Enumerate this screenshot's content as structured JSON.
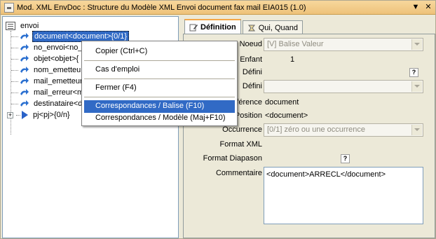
{
  "window": {
    "title": "Mod. XML EnvDoc : Structure du Modèle XML Envoi document fax mail EIA015 (1.0)",
    "controls": [
      "▼",
      "✕"
    ]
  },
  "tree": {
    "root": {
      "label": "envoi",
      "icon": "xml-doc-icon"
    },
    "items": [
      {
        "label": "document<document>{0/1}",
        "icon": "element-arrow-icon",
        "selected": true
      },
      {
        "label": "no_envoi<no_",
        "icon": "element-arrow-icon"
      },
      {
        "label": "objet<objet>{",
        "icon": "element-arrow-icon"
      },
      {
        "label": "nom_emetteur<",
        "icon": "element-arrow-icon"
      },
      {
        "label": "mail_emetteur<",
        "icon": "element-arrow-icon"
      },
      {
        "label": "mail_erreur<ma",
        "icon": "element-arrow-icon"
      },
      {
        "label": "destinataire<d",
        "icon": "element-arrow-icon"
      },
      {
        "label": "pj<pj>{0/n}",
        "icon": "play-icon",
        "expander": "+"
      }
    ]
  },
  "tabs": [
    {
      "label": "Définition",
      "active": true,
      "icon": "pencil-icon"
    },
    {
      "label": "Qui, Quand",
      "active": false,
      "icon": "clock-icon"
    }
  ],
  "form": {
    "type_noeud": {
      "label": "Type Noeud",
      "value": "[V] Balise Valeur"
    },
    "nb_enfant": {
      "label": "Nb Enfant",
      "value": "1"
    },
    "defini1": {
      "label": "Défini"
    },
    "defini2": {
      "label": "Défini"
    },
    "reference": {
      "label": "Référence",
      "value": "document"
    },
    "balise": {
      "label": "Balise/Position",
      "value": "<document>"
    },
    "occurrence": {
      "label": "Occurrence",
      "value": "[0/1] zéro ou une occurrence"
    },
    "format_xml": {
      "label": "Format XML"
    },
    "format_diapason": {
      "label": "Format Diapason"
    },
    "commentaire": {
      "label": "Commentaire",
      "value": "<document>ARRECL</document>"
    },
    "help_label": "?"
  },
  "context_menu": {
    "items": [
      {
        "label": "Copier (Ctrl+C)"
      },
      {
        "label": "Cas d'emploi"
      },
      {
        "label": "Fermer (F4)"
      },
      {
        "label": "Correspondances / Balise (F10)",
        "highlight": true
      },
      {
        "label": "Correspondances / Modèle (Maj+F10)"
      }
    ]
  },
  "colors": {
    "selection": "#316ac5",
    "title_bar": "#eec27a",
    "tab_accent": "#f3a84a"
  }
}
